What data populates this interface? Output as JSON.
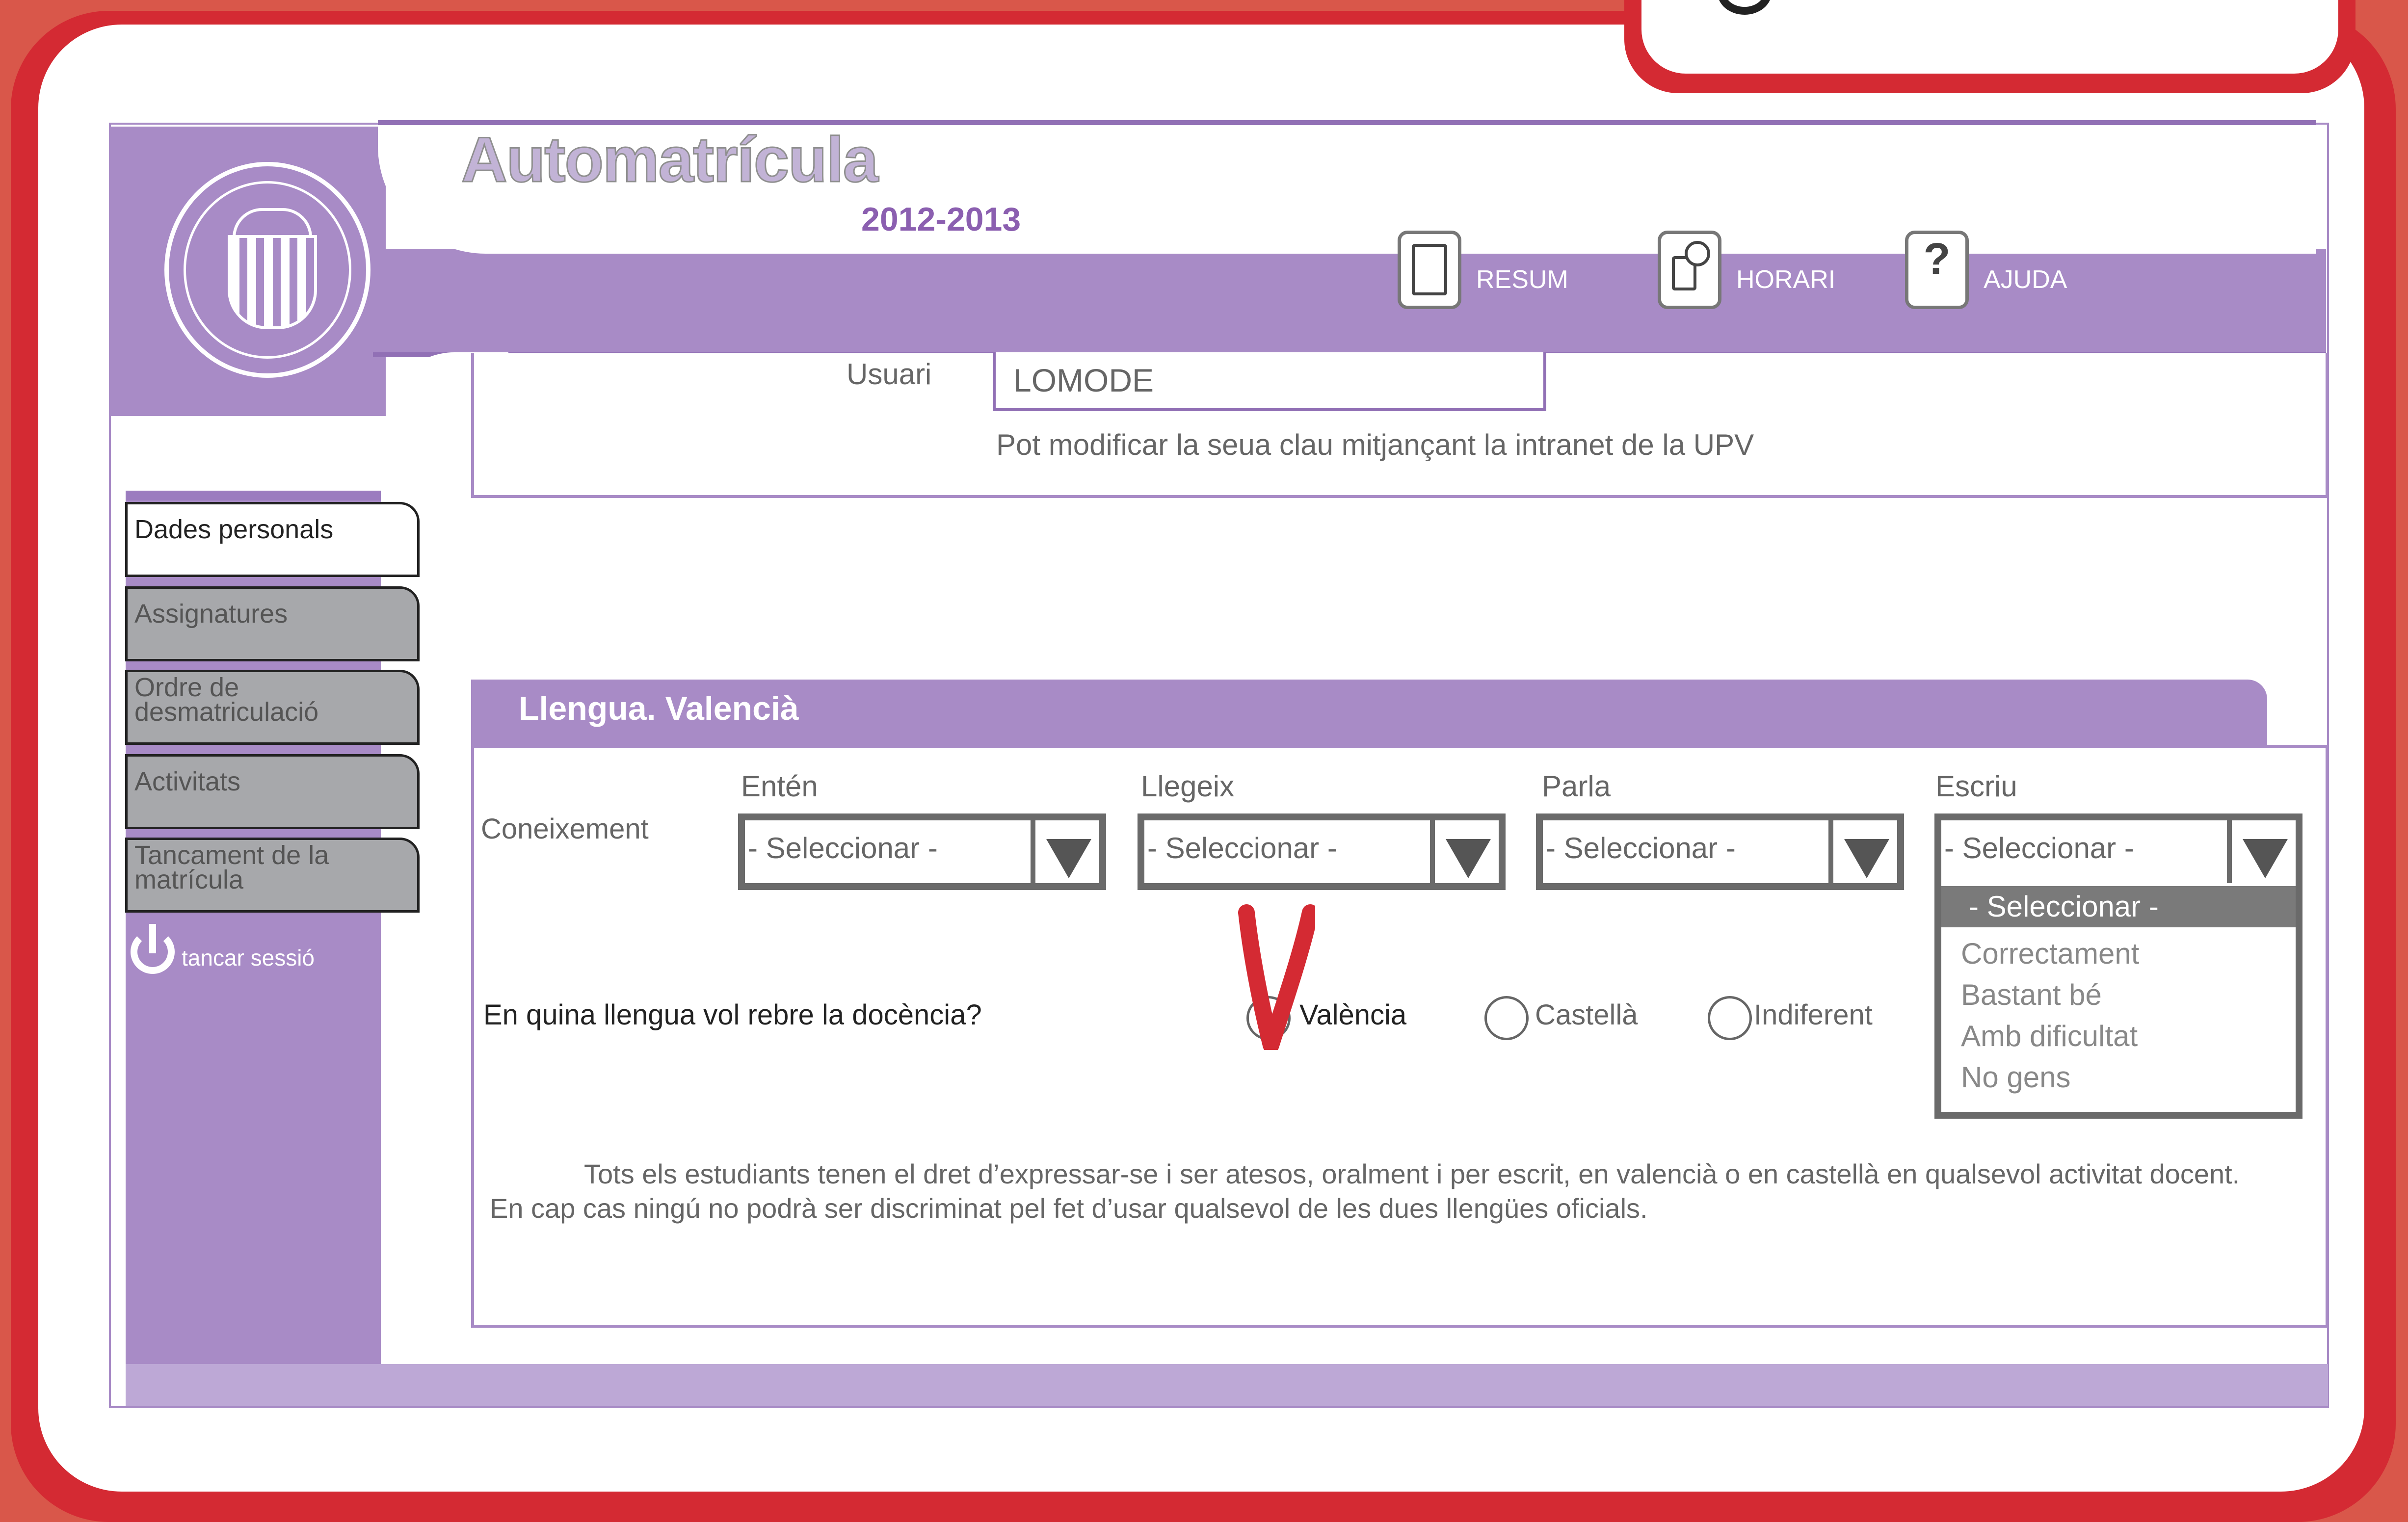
{
  "window": {
    "title": "Automatrícula",
    "year": "2012-2013"
  },
  "header": {
    "buttons": [
      {
        "label": "RESUM",
        "icon": "document-icon"
      },
      {
        "label": "HORARI",
        "icon": "clock-document-icon"
      },
      {
        "label": "AJUDA",
        "icon": "help-icon"
      }
    ],
    "help_glyph": "?"
  },
  "user": {
    "label": "Usuari",
    "value": "LOMODE",
    "hint": "Pot modificar la seua clau mitjançant la intranet de la UPV"
  },
  "sidebar": {
    "items": [
      {
        "label": "Dades personals",
        "active": true
      },
      {
        "label": "Assignatures",
        "active": false
      },
      {
        "label": "Ordre de desmatriculació",
        "active": false
      },
      {
        "label": "Activitats",
        "active": false
      },
      {
        "label": "Tancament de la matrícula",
        "active": false
      }
    ],
    "logout_label": "tancar sessió"
  },
  "language": {
    "section_title": "Llengua. Valencià",
    "knowledge_label": "Coneixement",
    "columns": [
      {
        "label": "Entén",
        "selected": "- Seleccionar -"
      },
      {
        "label": "Llegeix",
        "selected": "- Seleccionar -"
      },
      {
        "label": "Parla",
        "selected": "- Seleccionar -"
      },
      {
        "label": "Escriu",
        "selected": "- Seleccionar -"
      }
    ],
    "dropdown_options": [
      "- Seleccionar -",
      "Correctament",
      "Bastant bé",
      "Amb dificultat",
      "No gens"
    ],
    "question": "En quina llengua vol rebre la docència?",
    "radio_options": [
      "València",
      "Castellà",
      "Indiferent"
    ],
    "selected_radio": "València",
    "notice_line1": "Tots els estudiants tenen el dret d’expressar-se i ser atesos, oralment i per escrit, en valencià o en castellà en qualsevol activitat docent.",
    "notice_line2": "En cap cas ningú no podrà ser discriminat pel fet d’usar qualsevol de les dues llengües oficials."
  },
  "colors": {
    "brand_purple": "#a88bc6",
    "frame_red": "#d42a33",
    "annotation_red": "#d42a33"
  }
}
